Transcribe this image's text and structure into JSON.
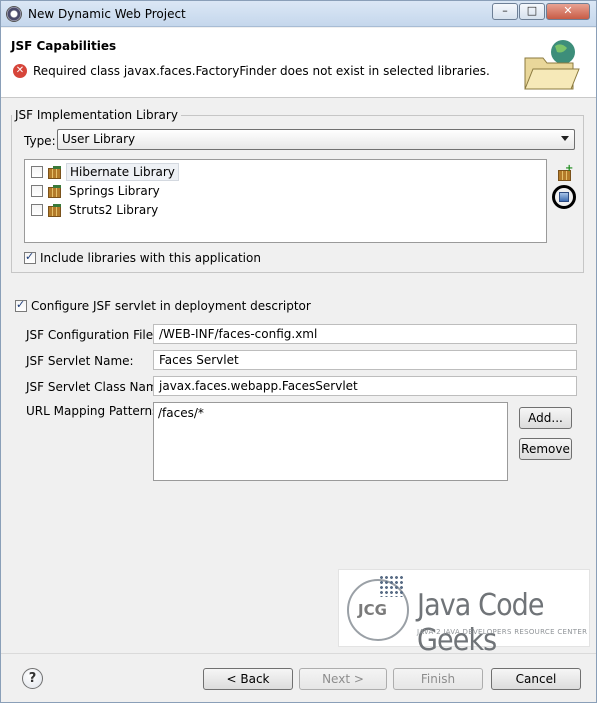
{
  "window": {
    "title": "New Dynamic Web Project",
    "controls": [
      "–",
      "□",
      "✕"
    ]
  },
  "header": {
    "title": "JSF Capabilities",
    "error_message": "Required class javax.faces.FactoryFinder does not exist in selected libraries."
  },
  "implementation": {
    "group_title": "JSF Implementation Library",
    "type_label": "Type:",
    "type_value": "User Library",
    "libraries": [
      {
        "label": "Hibernate Library",
        "checked": false,
        "selected": true
      },
      {
        "label": "Springs Library",
        "checked": false,
        "selected": false
      },
      {
        "label": "Struts2 Library",
        "checked": false,
        "selected": false
      }
    ],
    "include_label": "Include libraries with this application",
    "include_checked": true
  },
  "servlet": {
    "configure_label": "Configure JSF servlet in deployment descriptor",
    "configure_checked": true,
    "config_file_label": "JSF Configuration File:",
    "config_file_value": "/WEB-INF/faces-config.xml",
    "servlet_name_label": "JSF Servlet Name:",
    "servlet_name_value": "Faces Servlet",
    "servlet_class_label": "JSF Servlet Class Name:",
    "servlet_class_value": "javax.faces.webapp.FacesServlet",
    "url_mapping_label": "URL Mapping Patterns:",
    "url_mappings": [
      "/faces/*"
    ],
    "add_label": "Add...",
    "remove_label": "Remove"
  },
  "watermark": {
    "logo_text": "JCG",
    "title": "Java Code Geeks",
    "subtitle": "JAVA 2 JAVA DEVELOPERS RESOURCE CENTER"
  },
  "footer": {
    "help_symbol": "?",
    "back_label": "< Back",
    "next_label": "Next >",
    "finish_label": "Finish",
    "cancel_label": "Cancel"
  }
}
